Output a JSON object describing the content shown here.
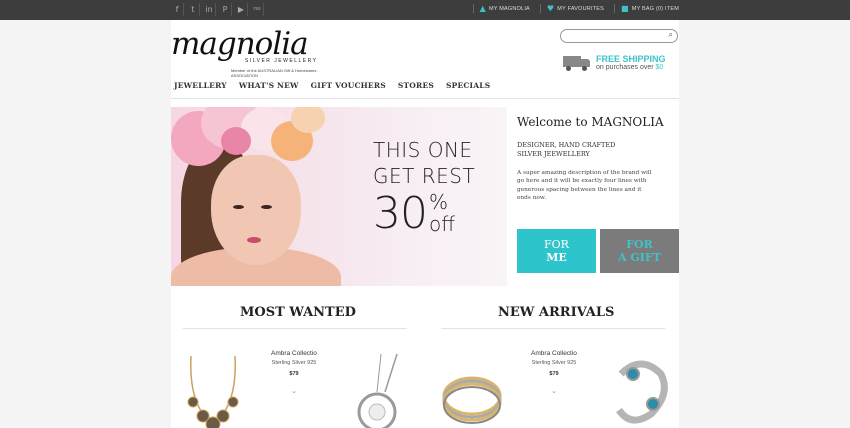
{
  "topbar": {
    "social": [
      "f",
      "t",
      "in",
      "P",
      "▶",
      "rss"
    ],
    "account": [
      {
        "icon": "user-icon",
        "glyph": "▲",
        "label": "MY MAGNOLIA"
      },
      {
        "icon": "heart-icon",
        "glyph": "♥",
        "label": "MY FAVOURITES"
      },
      {
        "icon": "bag-icon",
        "glyph": "■",
        "label": "MY BAG   (0) ITEM"
      }
    ]
  },
  "logo": {
    "script": "magnolia",
    "silver": "SILVER JEWELLERY",
    "member": "Member of the  AUSTRALIAN Gift & Homewares ASSOCIATION"
  },
  "search": {
    "placeholder": "",
    "icon": "search-icon"
  },
  "shipping": {
    "title": "FREE SHIPPING",
    "prefix": "on purchases over ",
    "amount": "$0"
  },
  "nav": [
    "JEWELLERY",
    "WHAT'S NEW",
    "GIFT VOUCHERS",
    "STORES",
    "SPECIALS"
  ],
  "hero": {
    "line1": "THIS ONE",
    "line2": "GET REST",
    "number": "30",
    "percent": "%",
    "off": "off"
  },
  "welcome": {
    "title": "Welcome to MAGNOLIA",
    "tagline": "DESIGNER, HAND CRAFTED\nSILVER JEEWELLERY",
    "description": "A super amazing description of the brand will go here and it will be exactly four lines with generous spacing between the lines and it ends now.",
    "cta_me_top": "FOR",
    "cta_me_bottom": "ME",
    "cta_gift_top": "FOR",
    "cta_gift_bottom": "A GIFT"
  },
  "sections": {
    "most_wanted": "MOST WANTED",
    "new_arrivals": "NEW ARRIVALS"
  },
  "products": [
    {
      "name": "Ambra Collectio",
      "material": "Sterling Silver 925",
      "price": "$79"
    },
    {
      "name": "Ambra Collectio",
      "material": "Sterling Silver 925",
      "price": "$79"
    }
  ],
  "colors": {
    "accent": "#3ec3c9",
    "topbar": "#3d3d3d",
    "gift_button": "#7b7b7b"
  }
}
